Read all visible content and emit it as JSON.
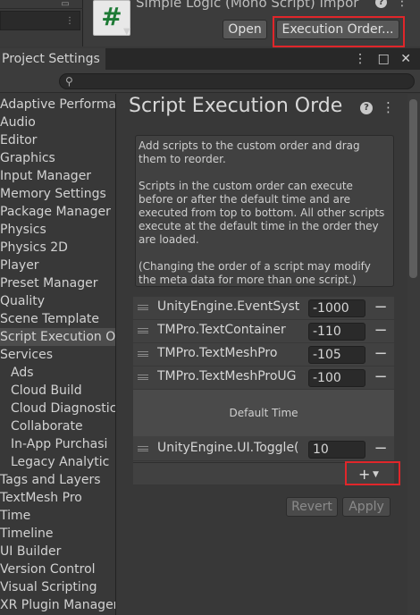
{
  "inspector": {
    "asset_title": "Simple Logic (Mono Script) Impor",
    "asset_icon_glyph": "#",
    "open_label": "Open",
    "execution_order_label": "Execution Order...",
    "highlight_color": "#e0262a"
  },
  "project_settings": {
    "tab_title": "Project Settings",
    "search": {
      "placeholder": "",
      "value": ""
    },
    "nav": [
      {
        "label": "Adaptive Performa",
        "sub": false,
        "selected": false
      },
      {
        "label": "Audio",
        "sub": false,
        "selected": false
      },
      {
        "label": "Editor",
        "sub": false,
        "selected": false
      },
      {
        "label": "Graphics",
        "sub": false,
        "selected": false
      },
      {
        "label": "Input Manager",
        "sub": false,
        "selected": false
      },
      {
        "label": "Memory Settings",
        "sub": false,
        "selected": false
      },
      {
        "label": "Package Manager",
        "sub": false,
        "selected": false
      },
      {
        "label": "Physics",
        "sub": false,
        "selected": false
      },
      {
        "label": "Physics 2D",
        "sub": false,
        "selected": false
      },
      {
        "label": "Player",
        "sub": false,
        "selected": false
      },
      {
        "label": "Preset Manager",
        "sub": false,
        "selected": false
      },
      {
        "label": "Quality",
        "sub": false,
        "selected": false
      },
      {
        "label": "Scene Template",
        "sub": false,
        "selected": false
      },
      {
        "label": "Script Execution Or",
        "sub": false,
        "selected": true
      },
      {
        "label": "Services",
        "sub": false,
        "selected": false
      },
      {
        "label": "Ads",
        "sub": true,
        "selected": false
      },
      {
        "label": "Cloud Build",
        "sub": true,
        "selected": false
      },
      {
        "label": "Cloud Diagnostic",
        "sub": true,
        "selected": false
      },
      {
        "label": "Collaborate",
        "sub": true,
        "selected": false
      },
      {
        "label": "In-App Purchasi",
        "sub": true,
        "selected": false
      },
      {
        "label": "Legacy Analytic",
        "sub": true,
        "selected": false
      },
      {
        "label": "Tags and Layers",
        "sub": false,
        "selected": false
      },
      {
        "label": "TextMesh Pro",
        "sub": false,
        "selected": false
      },
      {
        "label": "Time",
        "sub": false,
        "selected": false
      },
      {
        "label": "Timeline",
        "sub": false,
        "selected": false
      },
      {
        "label": "UI Builder",
        "sub": false,
        "selected": false
      },
      {
        "label": "Version Control",
        "sub": false,
        "selected": false
      },
      {
        "label": "Visual Scripting",
        "sub": false,
        "selected": false
      },
      {
        "label": "XR Plugin Manager",
        "sub": false,
        "selected": false
      }
    ]
  },
  "main": {
    "title": "Script Execution Orde",
    "help_paragraphs": [
      "Add scripts to the custom order and drag them to reorder.",
      "Scripts in the custom order can execute before or after the default time and are executed from top to bottom. All other scripts execute at the default time in the order they are loaded.",
      "(Changing the order of a script may modify the meta data for more than one script.)"
    ],
    "rows_before": [
      {
        "name": "UnityEngine.EventSyst",
        "value": "-1000"
      },
      {
        "name": "TMPro.TextContainer",
        "value": "-110"
      },
      {
        "name": "TMPro.TextMeshPro",
        "value": "-105"
      },
      {
        "name": "TMPro.TextMeshProUG",
        "value": "-100"
      }
    ],
    "default_time_label": "Default Time",
    "rows_after": [
      {
        "name": "UnityEngine.UI.Toggle(",
        "value": "10"
      }
    ],
    "add_label": "+",
    "revert_label": "Revert",
    "apply_label": "Apply"
  }
}
